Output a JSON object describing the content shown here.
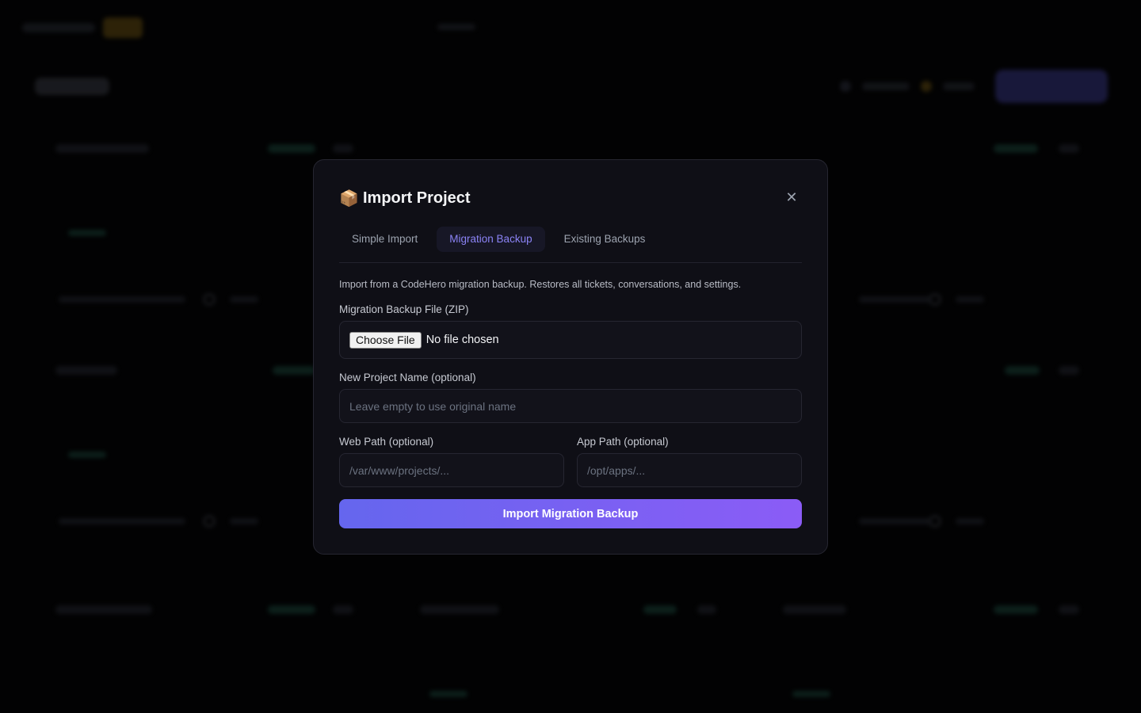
{
  "modal": {
    "icon": "📦",
    "title": "Import Project",
    "close_icon": "✕"
  },
  "tabs": [
    {
      "label": "Simple Import",
      "active": false
    },
    {
      "label": "Migration Backup",
      "active": true
    },
    {
      "label": "Existing Backups",
      "active": false
    }
  ],
  "form": {
    "description": "Import from a CodeHero migration backup. Restores all tickets, conversations, and settings.",
    "backup_file": {
      "label": "Migration Backup File (ZIP)",
      "button_label": "Choose File",
      "status": "No file chosen"
    },
    "project_name": {
      "label": "New Project Name (optional)",
      "placeholder": "Leave empty to use original name",
      "value": ""
    },
    "web_path": {
      "label": "Web Path (optional)",
      "placeholder": "/var/www/projects/...",
      "value": ""
    },
    "app_path": {
      "label": "App Path (optional)",
      "placeholder": "/opt/apps/...",
      "value": ""
    },
    "submit_label": "Import Migration Backup"
  },
  "colors": {
    "accent": "#8b83f6",
    "button_gradient_start": "#6566ee",
    "button_gradient_end": "#8b5cf6",
    "modal_bg": "#0f0f16"
  }
}
